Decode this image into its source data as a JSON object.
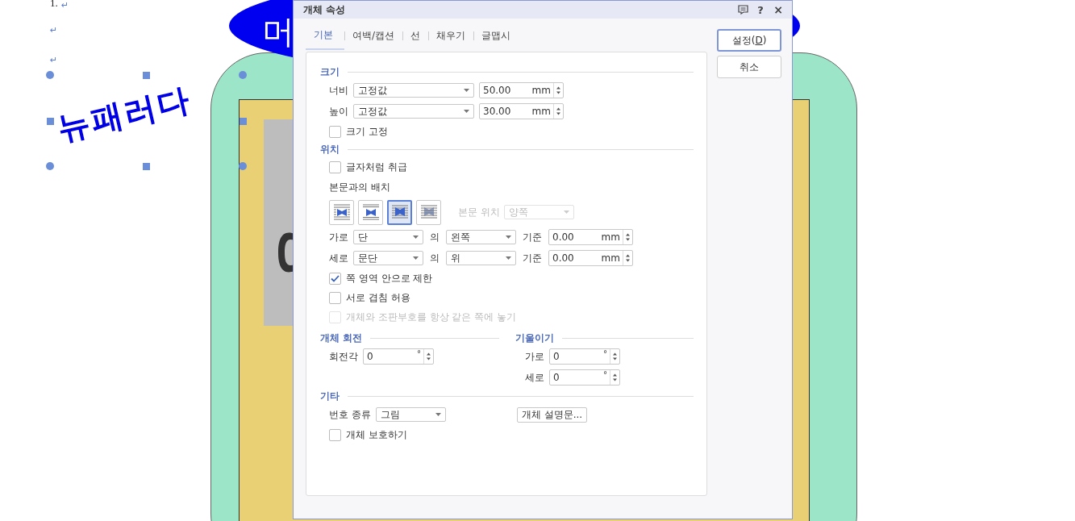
{
  "document": {
    "list_number": "1.",
    "paragraph_marks": [
      "↵",
      "↵",
      "↵"
    ],
    "wordart": "뉴패러다",
    "ellipse_text": "머"
  },
  "dialog": {
    "title": "개체 속성",
    "title_buttons": [
      "?",
      "×"
    ],
    "tabs": [
      {
        "label": "기본",
        "selected": true
      },
      {
        "label": "여백/캡션",
        "selected": false
      },
      {
        "label": "선",
        "selected": false
      },
      {
        "label": "채우기",
        "selected": false
      },
      {
        "label": "글맵시",
        "selected": false
      }
    ],
    "buttons": [
      {
        "label": "설정(",
        "key": "D",
        "tail": ")",
        "default": true
      },
      {
        "label": "취소",
        "default": false
      }
    ],
    "size": {
      "heading": "크기",
      "rows": [
        {
          "label": "너비",
          "mode": "고정값",
          "value": "50.00",
          "unit": "mm"
        },
        {
          "label": "높이",
          "mode": "고정값",
          "value": "30.00",
          "unit": "mm"
        }
      ],
      "lock": {
        "label": "크기 고정",
        "checked": false,
        "disabled": false
      }
    },
    "position": {
      "heading": "위치",
      "as_char": {
        "label": "글자처럼 취급",
        "checked": false,
        "disabled": false
      },
      "wrap_label": "본문과의 배치",
      "wrap_options": [
        {
          "kind": "square",
          "selected": false
        },
        {
          "kind": "topbottom",
          "selected": false
        },
        {
          "kind": "behind",
          "selected": true
        },
        {
          "kind": "front",
          "selected": false
        }
      ],
      "text_side": {
        "label": "본문 위치",
        "value": "양쪽",
        "disabled": true
      },
      "rows": [
        {
          "label": "가로",
          "anchor": "단",
          "of": "의",
          "side": "왼쪽",
          "base": "기준",
          "value": "0.00",
          "unit": "mm"
        },
        {
          "label": "세로",
          "anchor": "문단",
          "of": "의",
          "side": "위",
          "base": "기준",
          "value": "0.00",
          "unit": "mm"
        }
      ],
      "options": [
        {
          "label": "쪽 영역 안으로 제한",
          "checked": true,
          "disabled": false
        },
        {
          "label": "서로 겹침 허용",
          "checked": false,
          "disabled": false
        },
        {
          "label": "개체와 조판부호를 항상 같은 쪽에 놓기",
          "checked": false,
          "disabled": true
        }
      ]
    },
    "rotation": {
      "heading": "개체 회전",
      "label": "회전각",
      "value": "0",
      "unit": "°"
    },
    "skew": {
      "heading": "기울이기",
      "rows": [
        {
          "label": "가로",
          "value": "0",
          "unit": "°"
        },
        {
          "label": "세로",
          "value": "0",
          "unit": "°"
        }
      ]
    },
    "other": {
      "heading": "기타",
      "numbering_label": "번호 종류",
      "numbering_value": "그림",
      "description_button": "개체 설명문...",
      "protect": {
        "label": "개체 보호하기",
        "checked": false,
        "disabled": false
      }
    }
  }
}
